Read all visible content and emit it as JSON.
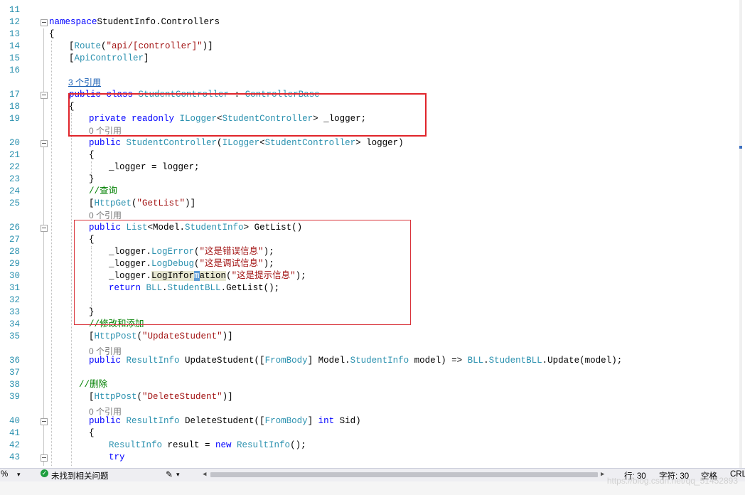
{
  "editor": {
    "lines": [
      {
        "n": "11",
        "code": []
      },
      {
        "n": "12",
        "fold": true,
        "code": [
          [
            "kw",
            "namespace"
          ],
          [
            "",
            "StudentInfo.Controllers"
          ]
        ]
      },
      {
        "n": "13",
        "code": [
          [
            "",
            "{"
          ]
        ]
      },
      {
        "n": "14",
        "code": [
          [
            "",
            "["
          ],
          [
            "ty",
            "Route"
          ],
          [
            "",
            "("
          ],
          [
            "st",
            "\"api/[controller]\""
          ],
          [
            "",
            ")]"
          ]
        ]
      },
      {
        "n": "15",
        "code": [
          [
            "",
            "["
          ],
          [
            "ty",
            "ApiController"
          ],
          [
            "",
            "]"
          ]
        ]
      },
      {
        "n": "16",
        "code": []
      },
      {
        "n": "17",
        "fold": true,
        "code": [
          [
            "kw",
            "public class "
          ],
          [
            "ty",
            "StudentController"
          ],
          [
            "",
            " : "
          ],
          [
            "ty",
            "ControllerBase"
          ]
        ]
      },
      {
        "n": "18",
        "code": [
          [
            "",
            "{"
          ]
        ]
      },
      {
        "n": "19",
        "code": [
          [
            "kw",
            "private readonly "
          ],
          [
            "ty",
            "ILogger"
          ],
          [
            "",
            "<"
          ],
          [
            "ty",
            "StudentController"
          ],
          [
            "",
            "> _logger;"
          ]
        ]
      },
      {
        "n": "20",
        "fold": true,
        "code": [
          [
            "kw",
            "public "
          ],
          [
            "ty",
            "StudentController"
          ],
          [
            "",
            "("
          ],
          [
            "ty",
            "ILogger"
          ],
          [
            "",
            "<"
          ],
          [
            "ty",
            "StudentController"
          ],
          [
            "",
            "> logger)"
          ]
        ]
      },
      {
        "n": "21",
        "code": [
          [
            "",
            "{"
          ]
        ]
      },
      {
        "n": "22",
        "code": [
          [
            "",
            "_logger = logger;"
          ]
        ]
      },
      {
        "n": "23",
        "code": [
          [
            "",
            "}"
          ]
        ]
      },
      {
        "n": "24",
        "code": [
          [
            "cm",
            "//查询"
          ]
        ]
      },
      {
        "n": "25",
        "code": [
          [
            "",
            "["
          ],
          [
            "ty",
            "HttpGet"
          ],
          [
            "",
            "("
          ],
          [
            "st",
            "\"GetList\""
          ],
          [
            "",
            ")]"
          ]
        ]
      },
      {
        "n": "26",
        "fold": true,
        "code": [
          [
            "kw",
            "public "
          ],
          [
            "ty",
            "List"
          ],
          [
            "",
            "<Model."
          ],
          [
            "ty",
            "StudentInfo"
          ],
          [
            "",
            "> GetList()"
          ]
        ]
      },
      {
        "n": "27",
        "code": [
          [
            "",
            "{"
          ]
        ]
      },
      {
        "n": "28",
        "code": [
          [
            "",
            "_logger."
          ],
          [
            "ty",
            "LogError"
          ],
          [
            "",
            "("
          ],
          [
            "st",
            "\"这是错误信息\""
          ],
          [
            "",
            ");"
          ]
        ]
      },
      {
        "n": "29",
        "code": [
          [
            "",
            "_logger."
          ],
          [
            "ty",
            "LogDebug"
          ],
          [
            "",
            "("
          ],
          [
            "st",
            "\"这是调试信息\""
          ],
          [
            "",
            ");"
          ]
        ]
      },
      {
        "n": "30",
        "code": [
          [
            "",
            "_logger."
          ],
          [
            "hl",
            "LogInfor"
          ],
          [
            "caret",
            "m"
          ],
          [
            "hl",
            "ation"
          ],
          [
            "",
            "("
          ],
          [
            "st",
            "\"这是提示信息\""
          ],
          [
            "",
            ");"
          ]
        ]
      },
      {
        "n": "31",
        "code": [
          [
            "kw",
            "return "
          ],
          [
            "ty",
            "BLL"
          ],
          [
            "",
            "."
          ],
          [
            "ty",
            "StudentBLL"
          ],
          [
            "",
            ".GetList();"
          ]
        ]
      },
      {
        "n": "32",
        "code": []
      },
      {
        "n": "33",
        "code": [
          [
            "",
            "}"
          ]
        ]
      },
      {
        "n": "34",
        "code": [
          [
            "cm",
            "//修改和添加"
          ]
        ]
      },
      {
        "n": "35",
        "code": [
          [
            "",
            "["
          ],
          [
            "ty",
            "HttpPost"
          ],
          [
            "",
            "("
          ],
          [
            "st",
            "\"UpdateStudent\""
          ],
          [
            "",
            ")]"
          ]
        ]
      },
      {
        "n": "36",
        "code": [
          [
            "kw",
            "public "
          ],
          [
            "ty",
            "ResultInfo"
          ],
          [
            "",
            " UpdateStudent(["
          ],
          [
            "ty",
            "FromBody"
          ],
          [
            "",
            "] Model."
          ],
          [
            "ty",
            "StudentInfo"
          ],
          [
            "",
            " model) => "
          ],
          [
            "ty",
            "BLL"
          ],
          [
            "",
            "."
          ],
          [
            "ty",
            "StudentBLL"
          ],
          [
            "",
            ".Update(model);"
          ]
        ]
      },
      {
        "n": "37",
        "code": []
      },
      {
        "n": "38",
        "code": [
          [
            "cm",
            "//删除"
          ]
        ]
      },
      {
        "n": "39",
        "code": [
          [
            "",
            "["
          ],
          [
            "ty",
            "HttpPost"
          ],
          [
            "",
            "("
          ],
          [
            "st",
            "\"DeleteStudent\""
          ],
          [
            "",
            ")]"
          ]
        ]
      },
      {
        "n": "40",
        "fold": true,
        "code": [
          [
            "kw",
            "public "
          ],
          [
            "ty",
            "ResultInfo"
          ],
          [
            "",
            " DeleteStudent(["
          ],
          [
            "ty",
            "FromBody"
          ],
          [
            "",
            "] "
          ],
          [
            "kw",
            "int"
          ],
          [
            "",
            " Sid)"
          ]
        ]
      },
      {
        "n": "41",
        "code": [
          [
            "",
            "{"
          ]
        ]
      },
      {
        "n": "42",
        "code": [
          [
            "ty",
            "ResultInfo"
          ],
          [
            "",
            " result = "
          ],
          [
            "kw",
            "new "
          ],
          [
            "ty",
            "ResultInfo"
          ],
          [
            "",
            "();"
          ]
        ]
      },
      {
        "n": "43",
        "fold": true,
        "code": [
          [
            "kw",
            "try"
          ]
        ]
      }
    ],
    "codelens": [
      {
        "text": "3 个引用",
        "link": true
      },
      {
        "text": "0 个引用"
      },
      {
        "text": "0 个引用"
      },
      {
        "text": "0 个引用"
      },
      {
        "text": "0 个引用"
      }
    ]
  },
  "status": {
    "zoom": "%",
    "issues": "未找到相关问题",
    "row": "行: 30",
    "col": "字符: 30",
    "spaces": "空格",
    "eol": "CRL"
  },
  "watermark": "https://blog.csdn.net/qq_51452893"
}
